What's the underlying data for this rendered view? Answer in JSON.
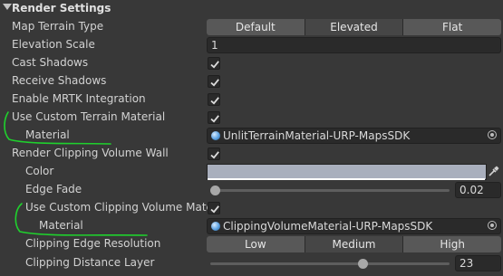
{
  "header": {
    "title": "Render Settings"
  },
  "map_terrain_type": {
    "label": "Map Terrain Type",
    "options": [
      "Default",
      "Elevated",
      "Flat"
    ],
    "selected": "Elevated"
  },
  "elevation_scale": {
    "label": "Elevation Scale",
    "value": "1"
  },
  "cast_shadows": {
    "label": "Cast Shadows",
    "checked": true
  },
  "receive_shadows": {
    "label": "Receive Shadows",
    "checked": true
  },
  "enable_mrtk": {
    "label": "Enable MRTK Integration",
    "checked": true
  },
  "use_custom_terrain_material": {
    "label": "Use Custom Terrain Material",
    "checked": true
  },
  "terrain_material": {
    "label": "Material",
    "value": "UnlitTerrainMaterial-URP-MapsSDK"
  },
  "render_clipping_volume_wall": {
    "label": "Render Clipping Volume Wall",
    "checked": true
  },
  "color": {
    "label": "Color",
    "value": "#a9afbd"
  },
  "edge_fade": {
    "label": "Edge Fade",
    "value": "0.02",
    "fraction": 0.02
  },
  "use_custom_clipping_material": {
    "label": "Use Custom Clipping Volume Mater",
    "checked": true
  },
  "clipping_material": {
    "label": "Material",
    "value": "ClippingVolumeMaterial-URP-MapsSDK"
  },
  "clipping_edge_resolution": {
    "label": "Clipping Edge Resolution",
    "options": [
      "Low",
      "Medium",
      "High"
    ],
    "selected": "Medium"
  },
  "clipping_distance_layer": {
    "label": "Clipping Distance Layer",
    "value": "23",
    "fraction": 0.64
  },
  "annotation_color": "#1fd12d"
}
